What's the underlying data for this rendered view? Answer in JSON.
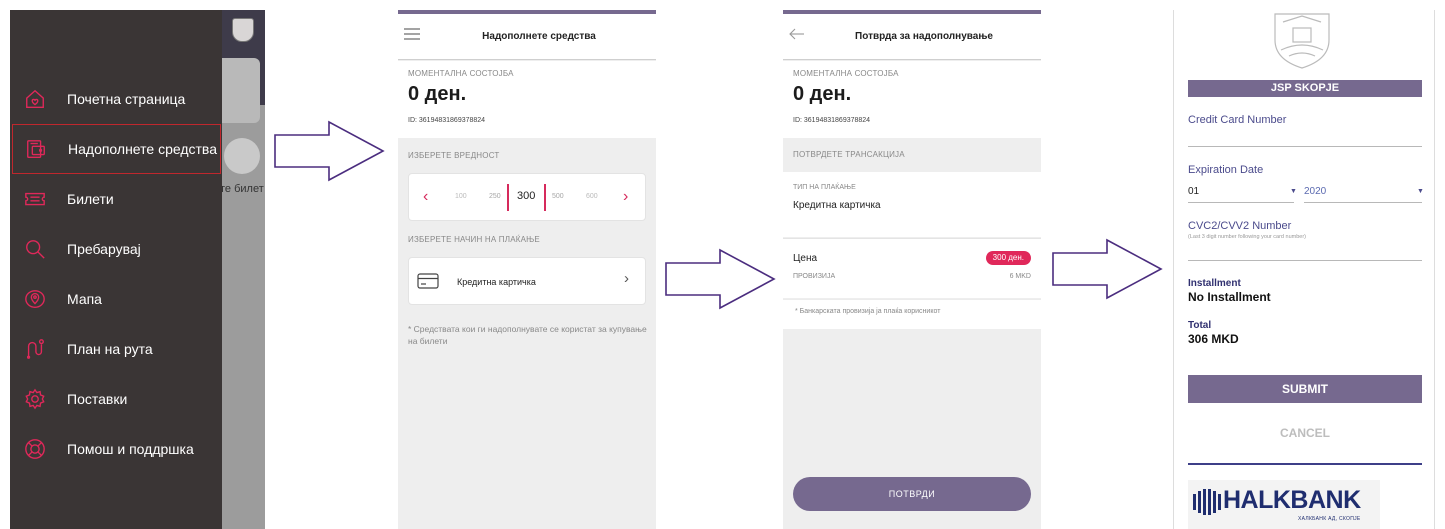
{
  "screen1": {
    "background_ticket_label": "те билет",
    "menu": [
      {
        "label": "Почетна страница",
        "icon": "home-icon"
      },
      {
        "label": "Надополнете средства",
        "icon": "wallet-icon",
        "active": true
      },
      {
        "label": "Билети",
        "icon": "ticket-icon"
      },
      {
        "label": "Пребарувај",
        "icon": "search-icon"
      },
      {
        "label": "Мапа",
        "icon": "map-pin-icon"
      },
      {
        "label": "План на рута",
        "icon": "route-icon"
      },
      {
        "label": "Поставки",
        "icon": "gear-icon"
      },
      {
        "label": "Помош и поддршка",
        "icon": "lifebuoy-icon"
      }
    ],
    "colors": {
      "drawer": "#3a3535",
      "icon": "#e0285a",
      "active_border": "#c0272d"
    }
  },
  "screen2": {
    "title": "Надополнете средства",
    "balance_label": "МОМЕНТАЛНА СОСТОЈБА",
    "balance_amount": "0 ден.",
    "account_id": "ID: 36194831869378824",
    "choose_value_label": "ИЗБЕРЕТЕ ВРЕДНОСТ",
    "values": [
      "100",
      "250",
      "300",
      "500",
      "600"
    ],
    "selected_value": "300",
    "choose_method_label": "ИЗБЕРЕТЕ НАЧИН НА ПЛАЌАЊЕ",
    "payment_method": "Кредитна картичка",
    "note": "* Средствата кои ги надополнувате се користат за купување на билети"
  },
  "screen3": {
    "title": "Потврда за надополнување",
    "balance_label": "МОМЕНТАЛНА СОСТОЈБА",
    "balance_amount": "0 ден.",
    "account_id": "ID: 36194831869378824",
    "confirm_label": "ПОТВРДЕТЕ ТРАНСАКЦИЈА",
    "payment_type_label": "ТИП НА ПЛАЌАЊЕ",
    "payment_type": "Кредитна картичка",
    "price_label": "Цена",
    "price": "300 ден.",
    "fee_label": "ПРОВИЗИЈА",
    "fee": "6 MKD",
    "fee_note": "* Банкарската провизија ја плаќа корисникот",
    "confirm_button": "ПОТВРДИ"
  },
  "screen4": {
    "merchant": "JSP SKOPJE",
    "card_number_label": "Credit Card Number",
    "expiration_label": "Expiration Date",
    "exp_month": "01",
    "exp_year": "2020",
    "cvc_label": "CVC2/CVV2 Number",
    "cvc_hint": "(Last 3 digit number following your card number)",
    "installment_label": "Installment",
    "installment_value": "No Installment",
    "total_label": "Total",
    "total_value": "306 MKD",
    "submit": "SUBMIT",
    "cancel": "CANCEL",
    "bank_name": "HALKBANK",
    "bank_sub": "ХАЛКБАНК АД, СКОПЈЕ",
    "colors": {
      "accent": "#76698f",
      "label": "#4b4b8c",
      "bank": "#1f2d6f"
    }
  }
}
